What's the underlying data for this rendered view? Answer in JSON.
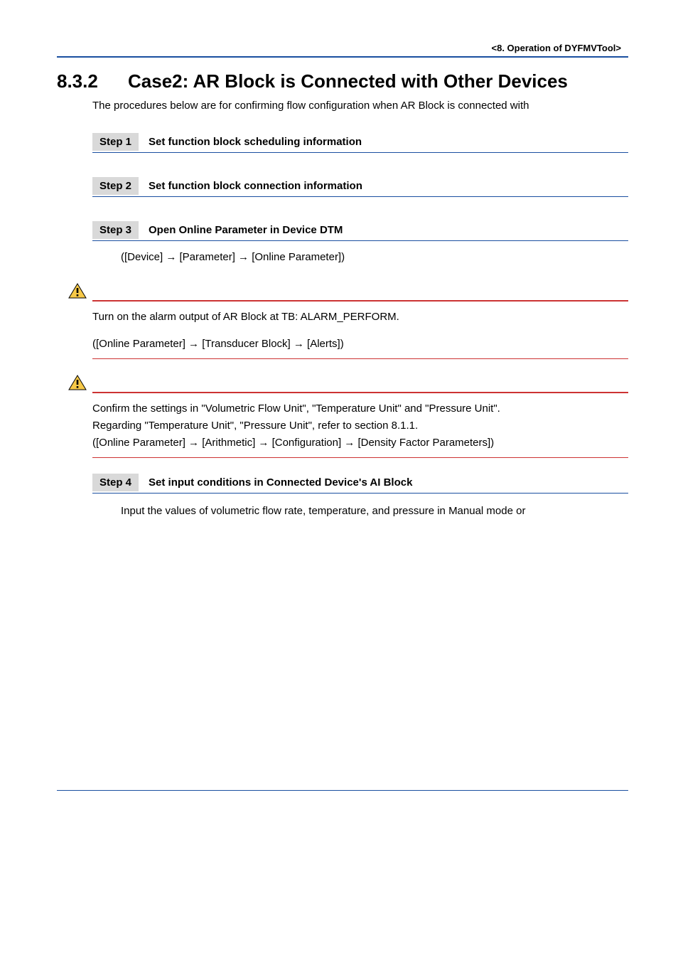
{
  "header": {
    "path": "<8.  Operation of DYFMVTool>"
  },
  "section": {
    "number": "8.3.2",
    "title": "Case2: AR Block is Connected with Other Devices",
    "intro": "The procedures below are for confirming flow configuration when AR Block is connected with"
  },
  "steps": {
    "s1": {
      "badge": "Step 1",
      "title": "Set function block scheduling information"
    },
    "s2": {
      "badge": "Step 2",
      "title": "Set function block connection information"
    },
    "s3": {
      "badge": "Step 3",
      "title": "Open Online Parameter in Device DTM",
      "path": "([Device] → [Parameter] → [Online Parameter])"
    },
    "s4": {
      "badge": "Step 4",
      "title": "Set input conditions in Connected Device's AI Block",
      "note": "Input the values of volumetric flow rate, temperature, and pressure in Manual mode or"
    }
  },
  "important1": {
    "line1": "Turn on the alarm output of AR Block at TB: ALARM_PERFORM.",
    "line2": "([Online Parameter] → [Transducer Block] → [Alerts])"
  },
  "important2": {
    "line1": "Confirm the settings in \"Volumetric Flow Unit\", \"Temperature Unit\" and \"Pressure Unit\".",
    "line2": "Regarding \"Temperature Unit\", \"Pressure Unit\", refer to section 8.1.1.",
    "line3": "([Online Parameter] → [Arithmetic] → [Configuration] → [Density Factor Parameters])"
  }
}
